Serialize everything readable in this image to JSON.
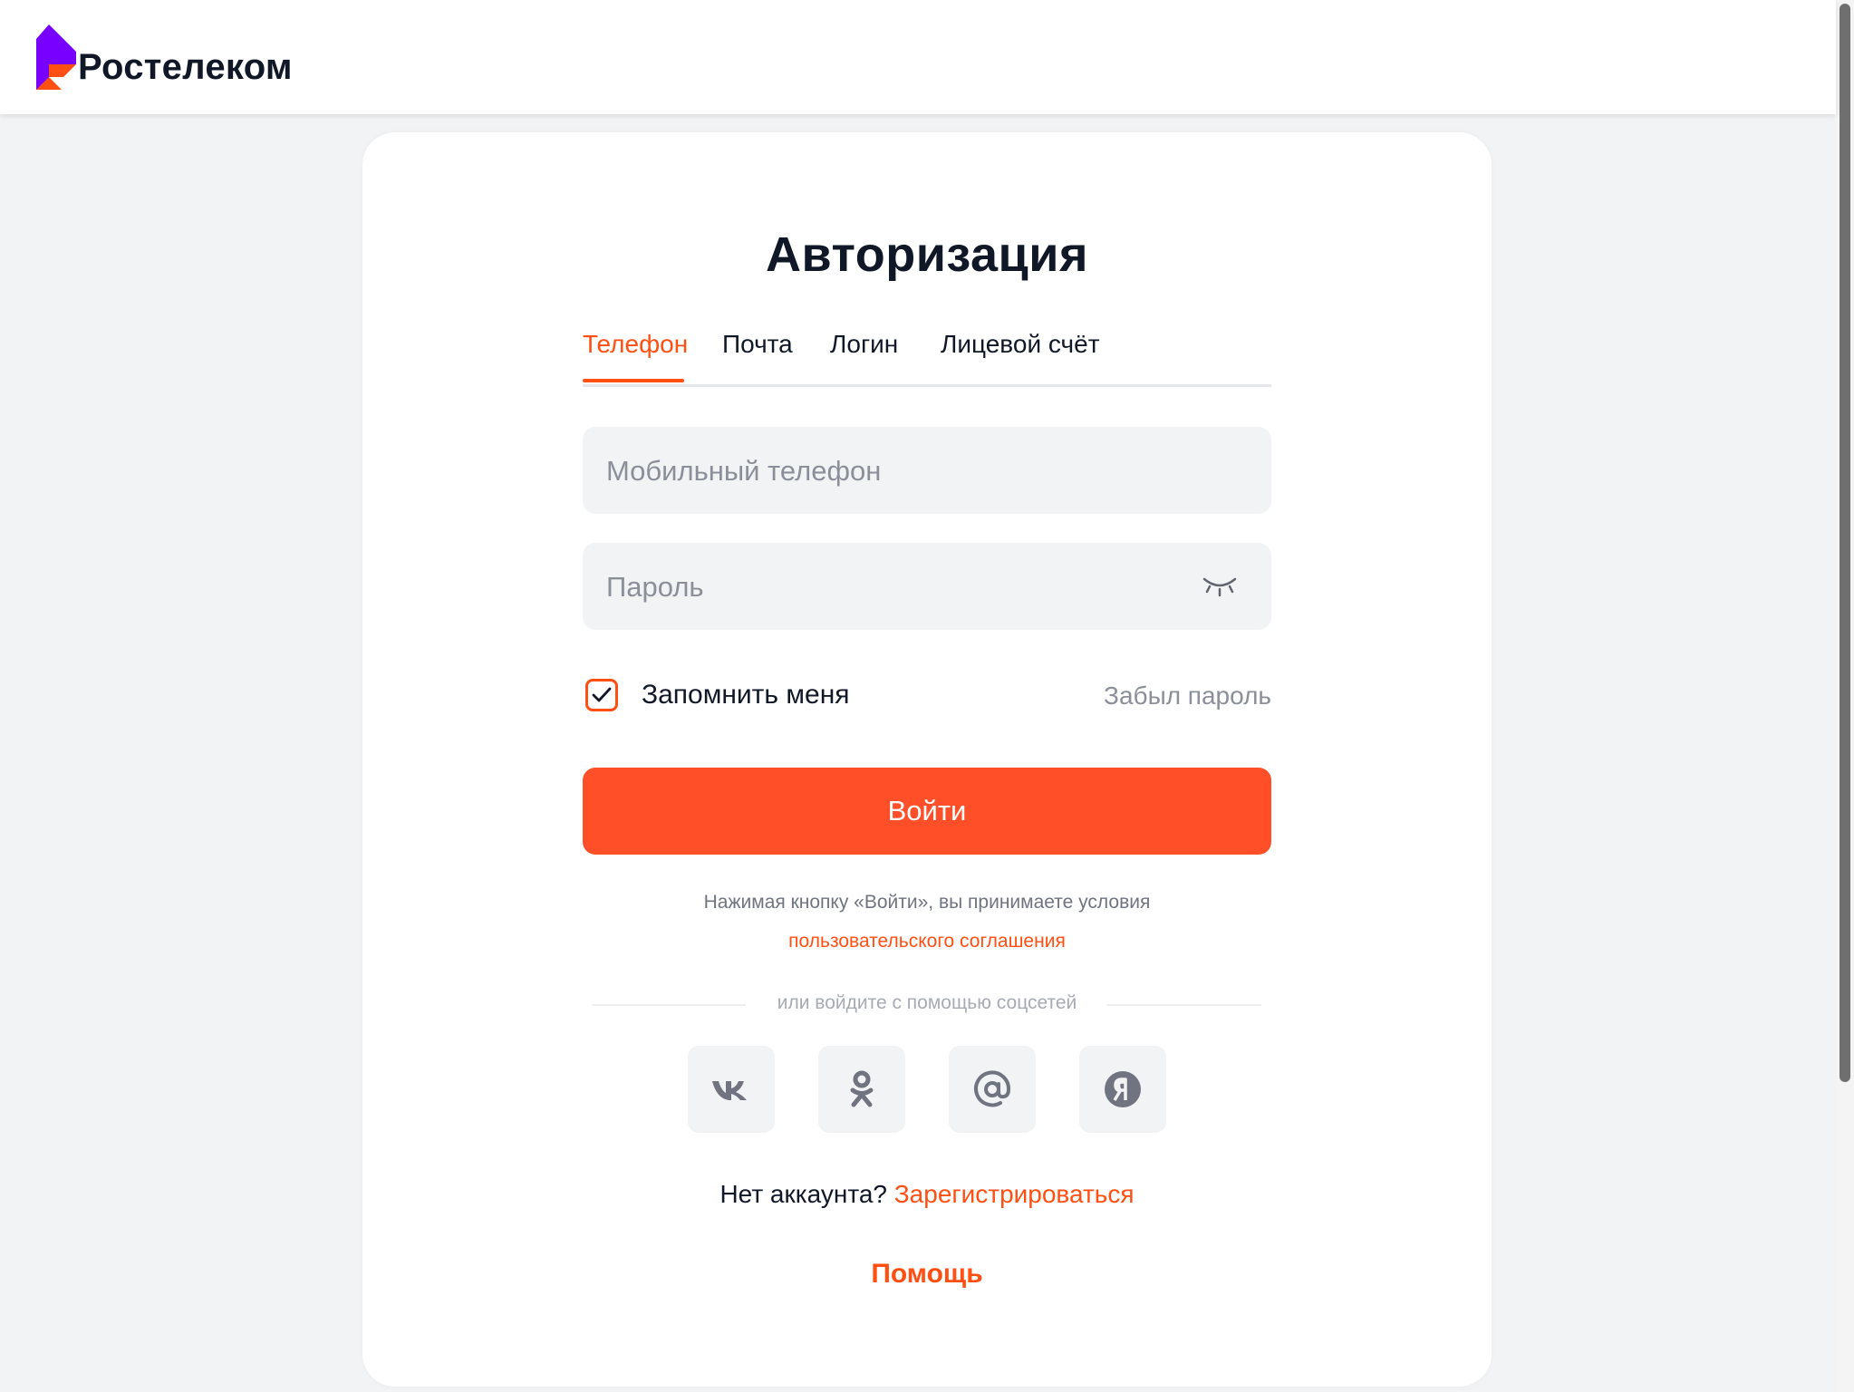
{
  "brand": {
    "name": "Ростелеком",
    "logo_colors": [
      "#7700ff",
      "#ff4f12"
    ]
  },
  "auth": {
    "title": "Авторизация",
    "tabs": [
      {
        "label": "Телефон",
        "active": true
      },
      {
        "label": "Почта",
        "active": false
      },
      {
        "label": "Логин",
        "active": false
      },
      {
        "label": "Лицевой счёт",
        "active": false
      }
    ],
    "phone_placeholder": "Мобильный телефон",
    "password_placeholder": "Пароль",
    "remember_label": "Запомнить меня",
    "remember_checked": true,
    "forgot_label": "Забыл пароль",
    "submit_label": "Войти",
    "terms_text": "Нажимая кнопку «Войти», вы принимаете условия",
    "terms_link": "пользовательского соглашения",
    "social_divider": "или войдите с помощью соцсетей",
    "social": [
      {
        "icon": "vk-icon"
      },
      {
        "icon": "odnoklassniki-icon"
      },
      {
        "icon": "mail-at-icon"
      },
      {
        "icon": "yandex-icon"
      }
    ],
    "no_account_text": "Нет аккаунта?",
    "register_link": "Зарегистрироваться",
    "help_label": "Помощь"
  },
  "colors": {
    "accent": "#ff4f12",
    "button": "#ff4f29",
    "text": "#101828",
    "muted": "#8a8f99",
    "field_bg": "#f2f3f5"
  }
}
